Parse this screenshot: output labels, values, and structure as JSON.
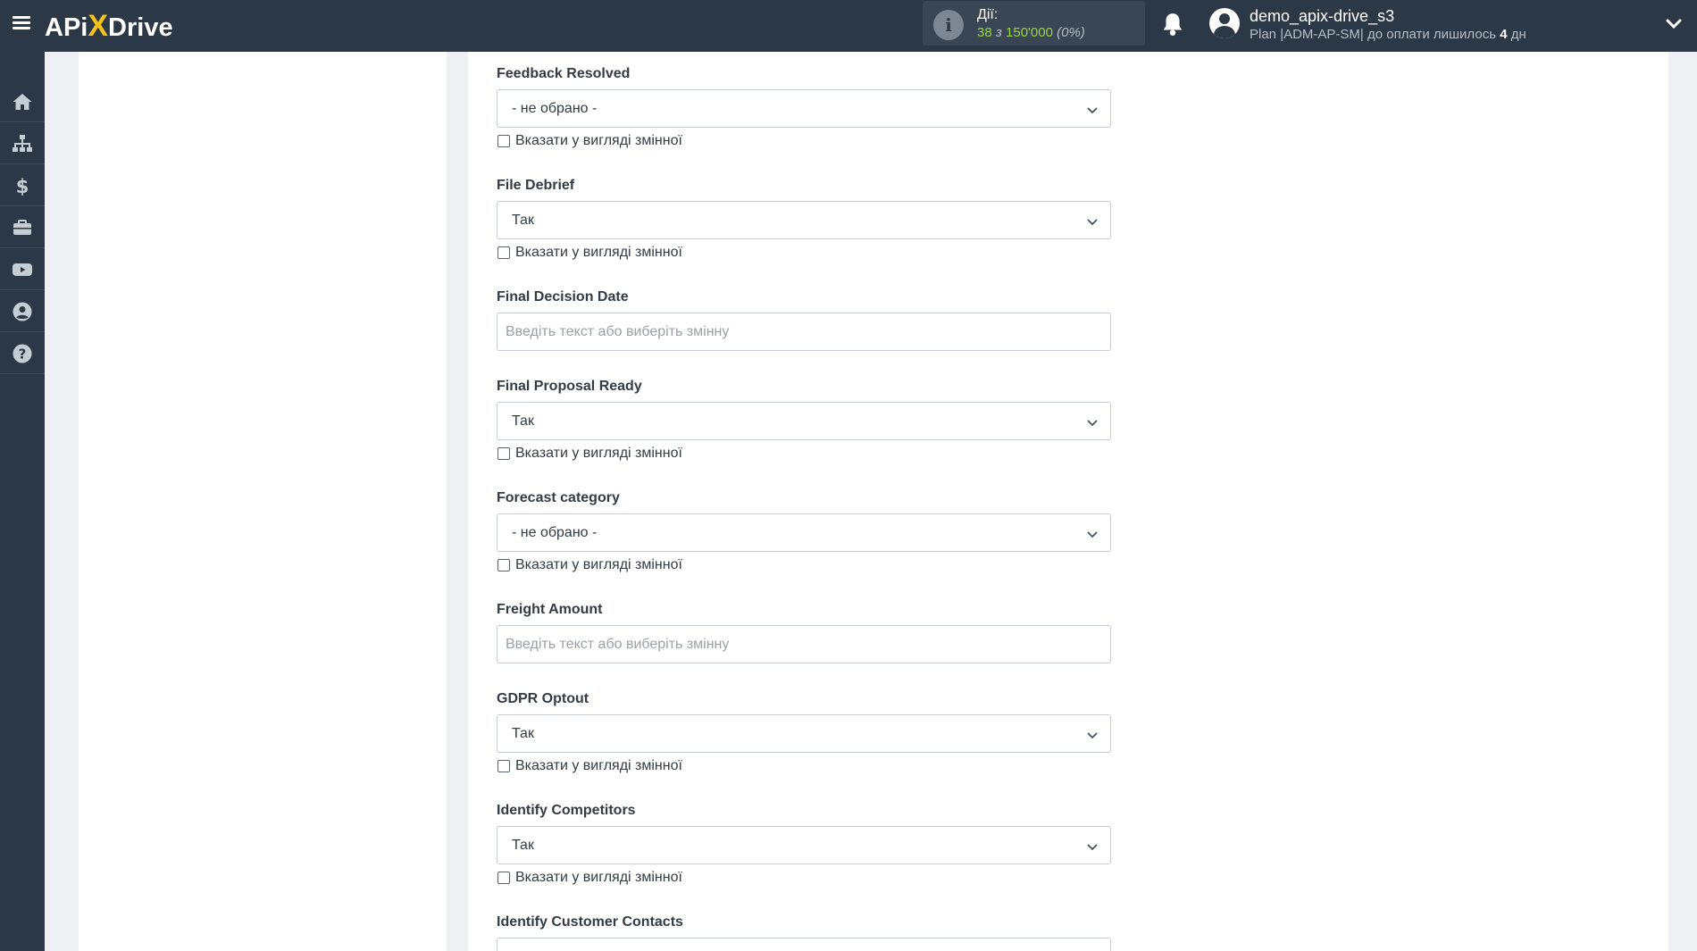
{
  "brand": {
    "logo_left": "APi",
    "logo_x": "X",
    "logo_right": "Drive"
  },
  "header": {
    "actions_label": "Дії:",
    "actions_used": "38",
    "actions_of": "з",
    "actions_total": "150'000",
    "actions_percent": "(0%)",
    "username": "demo_apix-drive_s3",
    "plan_prefix": "Plan |ADM-AP-SM| до оплати лишилось",
    "plan_days": "4",
    "plan_suffix": "дн"
  },
  "sidebar": {
    "items": [
      {
        "icon": "home-icon"
      },
      {
        "icon": "sitemap-icon"
      },
      {
        "icon": "dollar-icon"
      },
      {
        "icon": "briefcase-icon"
      },
      {
        "icon": "youtube-icon"
      },
      {
        "icon": "user-circle-icon"
      },
      {
        "icon": "help-icon"
      }
    ]
  },
  "form": {
    "variable_checkbox_label": "Вказати у вигляді змінної",
    "text_placeholder": "Введіть текст або виберіть змінну",
    "fields": [
      {
        "label": "Feedback Resolved",
        "type": "select",
        "value": "- не обрано -"
      },
      {
        "label": "File Debrief",
        "type": "select",
        "value": "Так"
      },
      {
        "label": "Final Decision Date",
        "type": "text",
        "value": ""
      },
      {
        "label": "Final Proposal Ready",
        "type": "select",
        "value": "Так"
      },
      {
        "label": "Forecast category",
        "type": "select",
        "value": "- не обрано -"
      },
      {
        "label": "Freight Amount",
        "type": "text",
        "value": ""
      },
      {
        "label": "GDPR Optout",
        "type": "select",
        "value": "Так"
      },
      {
        "label": "Identify Competitors",
        "type": "select",
        "value": "Так"
      },
      {
        "label": "Identify Customer Contacts",
        "type": "select",
        "value": ""
      }
    ]
  },
  "colors": {
    "topbar": "#2c3846",
    "accent_yellow": "#f4c21b",
    "actions_green": "#9ad14b"
  }
}
